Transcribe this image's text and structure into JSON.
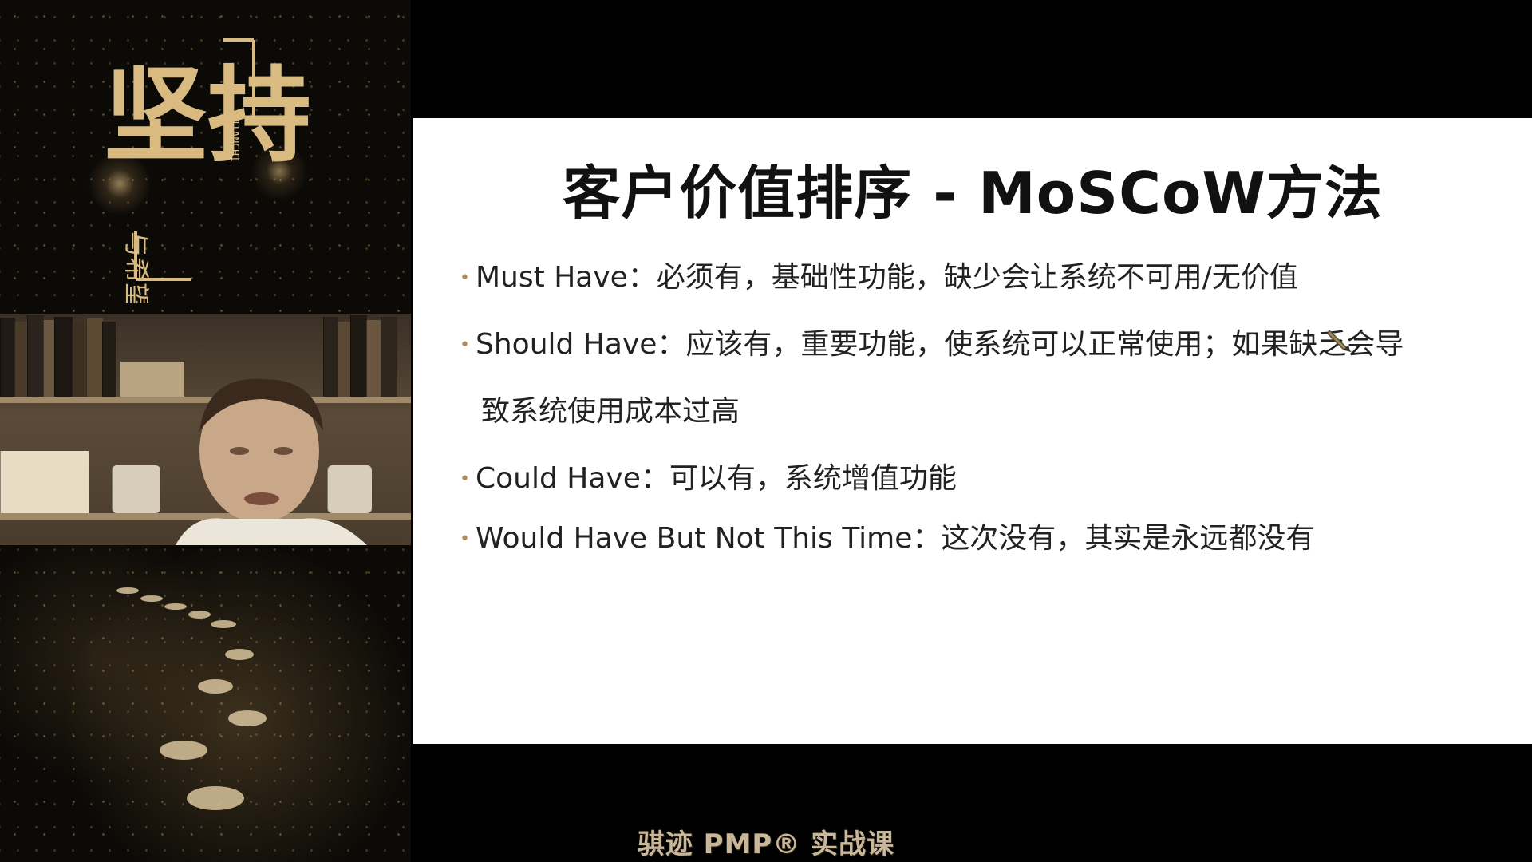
{
  "poster": {
    "main_calligraphy": "坚持",
    "subtitle": "与希望",
    "romanization": "JIANCHI"
  },
  "slide": {
    "title": "客户价值排序 - MoSCoW方法",
    "bullets": [
      {
        "text": "Must Have：必须有，基础性功能，缺少会让系统不可用/无价值"
      },
      {
        "text": "Should Have：应该有，重要功能，使系统可以正常使用；如果缺乏会导",
        "continuation": "致系统使用成本过高"
      },
      {
        "text": "Could Have：可以有，系统增值功能"
      },
      {
        "text": "Would Have But Not This Time：这次没有，其实是永远都没有"
      }
    ]
  },
  "footer": {
    "watermark": "骐迹 PMP® 实战课"
  },
  "colors": {
    "background": "#000000",
    "slide_background": "#ffffff",
    "gold_accent": "#c9a865"
  },
  "icons": {
    "bullet": "dot-icon",
    "cursor": "pencil-cursor-icon"
  }
}
